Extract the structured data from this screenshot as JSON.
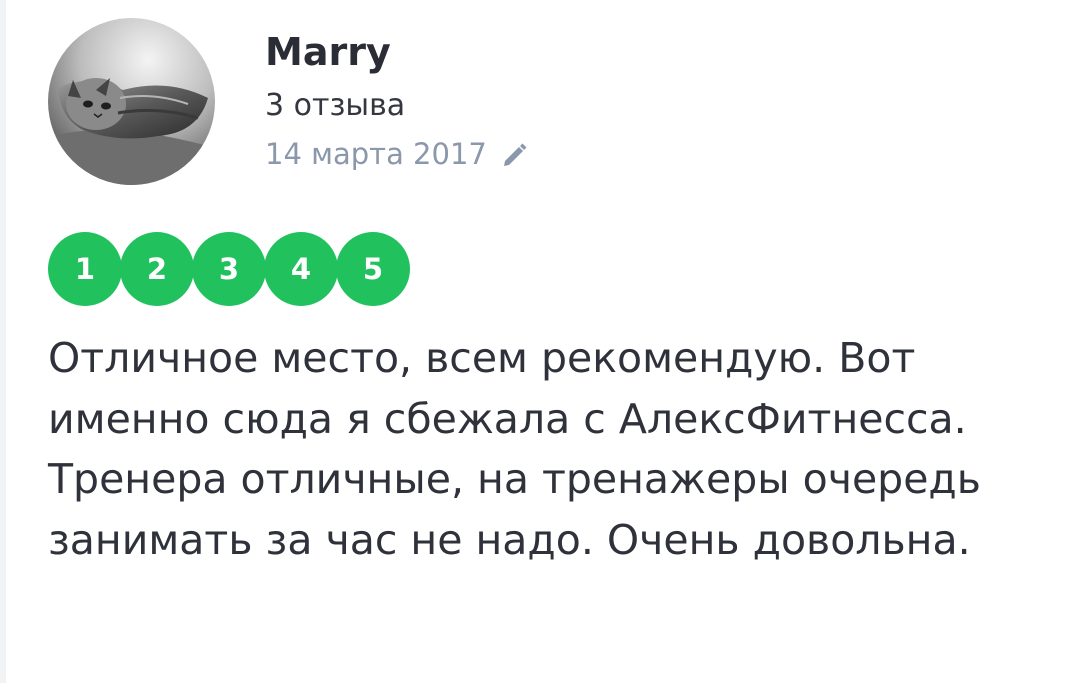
{
  "review": {
    "author": "Marry",
    "review_count": "3 отзыва",
    "date": "14 марта 2017",
    "rating": {
      "labels": [
        "1",
        "2",
        "3",
        "4",
        "5"
      ],
      "value": 5,
      "color": "#21c25e"
    },
    "text": "Отличное место, всем рекомендую. Вот именно сюда я сбежала с АлексФитнесса. Тренера отличные, на тренажеры очередь занимать за час не надо. Очень довольна."
  },
  "icons": {
    "avatar": "cat-photo",
    "edit": "pencil-icon"
  }
}
